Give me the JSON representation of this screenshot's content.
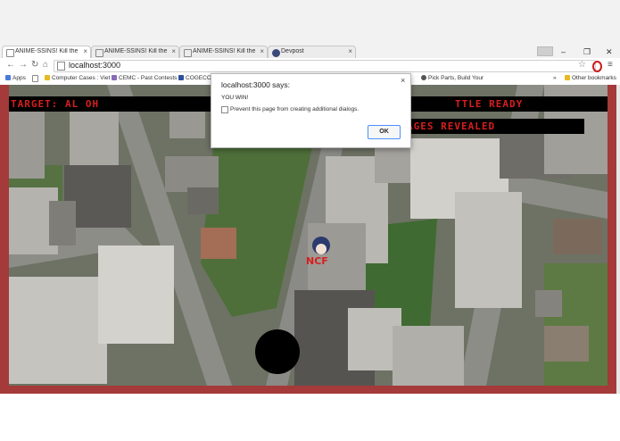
{
  "browser": {
    "tabs": [
      {
        "label": "ANIME-SSINS! Kill the oth",
        "active": true
      },
      {
        "label": "ANIME-SSINS! Kill the oth",
        "active": false
      },
      {
        "label": "ANIME-SSINS! Kill the oth",
        "active": false
      },
      {
        "label": "Devpost",
        "active": false
      }
    ],
    "url": "localhost:3000",
    "bookmarks": [
      {
        "label": "Apps",
        "icon": "apps-grid-icon"
      },
      {
        "label": "Computer Cases : Viet",
        "icon": "folder-icon"
      },
      {
        "label": "CEMC - Past Contests",
        "icon": "cemc-icon"
      },
      {
        "label": "COGECO",
        "icon": "cogeco-icon"
      },
      {
        "label": "Pick Parts, Build Your",
        "icon": "pcpartpicker-icon"
      }
    ],
    "bookmarks_overflow": "»",
    "other_bookmarks": "Other bookmarks",
    "colors": {
      "opera_red": "#cc1b1b",
      "game_border": "#a43a3a",
      "hud_text": "#d81e1e"
    }
  },
  "hud": {
    "target": "TARGET: AL OH",
    "status": "TTLE READY",
    "revealed": "AGES REVEALED"
  },
  "dialog": {
    "title": "localhost:3000 says:",
    "message": "YOU WIN!",
    "checkbox_label": "Prevent this page from creating additional dialogs.",
    "ok_label": "OK"
  },
  "player": {
    "label": "NCF"
  }
}
